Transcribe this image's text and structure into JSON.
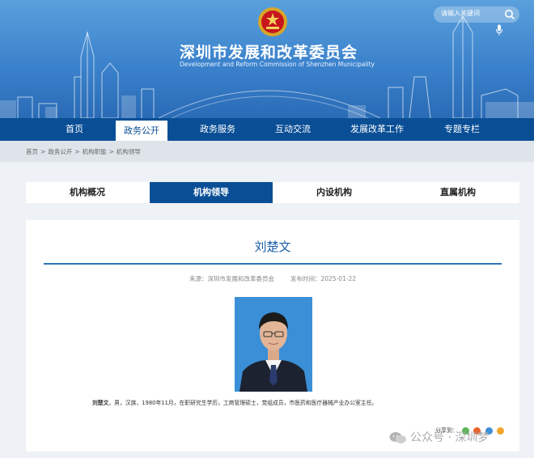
{
  "header": {
    "title_cn": "深圳市发展和改革委员会",
    "title_en": "Development and Reform Commission of Shenzhen Municipality",
    "search_placeholder": "请输入关键词"
  },
  "nav": {
    "items": [
      {
        "label": "首页"
      },
      {
        "label": "政务公开"
      },
      {
        "label": "政务服务"
      },
      {
        "label": "互动交流"
      },
      {
        "label": "发展改革工作"
      },
      {
        "label": "专题专栏"
      }
    ],
    "active_index": 1
  },
  "breadcrumb": {
    "items": [
      "首页",
      "政务公开",
      "机构职能",
      "机构领导"
    ],
    "separator": ">"
  },
  "tabs": {
    "items": [
      "机构概况",
      "机构领导",
      "内设机构",
      "直属机构"
    ],
    "active_index": 1
  },
  "article": {
    "title": "刘楚文",
    "source": "来源：深圳市发展和改革委员会",
    "date": "发布时间：2025-01-22",
    "bio_name": "刘楚文",
    "bio_text": "，男，汉族，1980年11月，在职研究生学历，工商管理硕士，党组成员，市医药和医疗器械产业办公室主任。"
  },
  "share": {
    "label": "分享到："
  },
  "watermark": {
    "text": "公众号 · 深圳梦"
  },
  "colors": {
    "nav_blue": "#0a4f96",
    "title_blue": "#1a5fa8",
    "portrait_bg": "#3a8fd6"
  }
}
